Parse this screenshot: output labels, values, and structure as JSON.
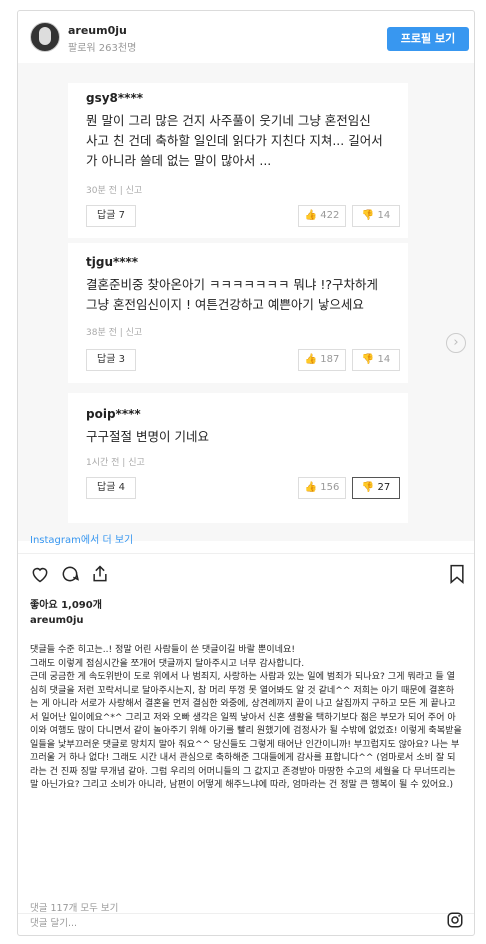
{
  "header": {
    "username": "areum0ju",
    "followers": "팔로워 263천명",
    "profile_button": "프로필 보기"
  },
  "comments": [
    {
      "user": "gsy8****",
      "text": "뭔 말이 그리 많은 건지 사주풀이 웃기네 그냥 혼전임신 사고 친 건데 축하할 일인데 읽다가 지친다 지쳐... 길어서가 아니라 쓸데 없는 말이 많아서 ...",
      "time": "30분 전",
      "report": "신고",
      "reply": "답글 7",
      "likes": "422",
      "dislikes": "14"
    },
    {
      "user": "tjgu****",
      "text": "결혼준비중 찾아온아기 ㅋㅋㅋㅋㅋㅋㅋ 뭐냐 !?구차하게 그냥 혼전임신이지 ! 여튼건강하고 예쁜아기 낳으세요",
      "time": "38분 전",
      "report": "신고",
      "reply": "답글 3",
      "likes": "187",
      "dislikes": "14"
    },
    {
      "user": "poip****",
      "text": "구구절절 변명이 기네요",
      "time": "1시간 전",
      "report": "신고",
      "reply": "답글 4",
      "likes": "156",
      "dislikes": "27"
    }
  ],
  "instagram_link": "Instagram에서 더 보기",
  "likes": "좋아요 1,090개",
  "caption_user": "areum0ju",
  "caption": "댓글들 수준 히고는..! 정말 어린 사람들이 쓴 댓글이길 바랄 뿐이네요!\n그래도 이렇게 점심시간을 쪼개어 댓글까지 달아주시고 너무 감사합니다.\n근데 궁금한 게 속도위반이 도로 위에서 나 범죄지, 사랑하는 사람과 있는 일에 범죄가 되나요? 그게 뭐라고 들 열심히 댓글을 저런 꼬락서니로 달아주시는지, 참 머리 뚜껑 못 열어봐도 알 것 같네^^ 저희는 아기 때문에 결혼하는 게 아니라 서로가 사랑해서 결혼을 먼저 결심한 와중에, 상견례까지 끝이 나고 살집까지 구하고 모든 게 끝나고서 일어난 일이에요^*^ 그리고 저와 오빠 생각은 일찍 낳아서 신혼 생활을 택하기보다 젊은 부모가 되어 주어 아이와 여행도 많이 다니면서 같이 놀아주기 위해 아기를 빨리 원했기에 검정사가 될 수밖에 없었죠! 이렇게 축복받을 일들을 낯부끄러운 댓글로 망치지 말아 줘요^^ 당신들도 그렇게 태어난 인간이니까! 부끄럽지도 않아요? 나는 부끄러울 거 하나 없다! 그래도 시간 내서 관심으로 축하해준 그대들에게 감사를 표합니다^^ (엄마로서 소비 잘 되라는 건 진짜 징말 무개념 같아. 그럼 우리의 어머니들의 그 값지고 존경받아 마땅한 수고의 세월을 다 무너뜨리는 말 아닌가요? 그리고 소비가 아니라, 남편이 어떻게 해주느냐에 따라, 엄마라는 건 정말 큰 행복이 될 수 있어요.)",
  "view_comments": "댓글 117개 모두 보기",
  "add_comment_placeholder": "댓글 달기...",
  "colors": {
    "accent": "#3897f0",
    "text": "#262626",
    "muted": "#999999"
  },
  "icons": [
    "heart-icon",
    "comment-icon",
    "share-icon",
    "bookmark-icon",
    "instagram-icon",
    "thumbs-up-icon",
    "thumbs-down-icon",
    "chevron-right-icon"
  ]
}
